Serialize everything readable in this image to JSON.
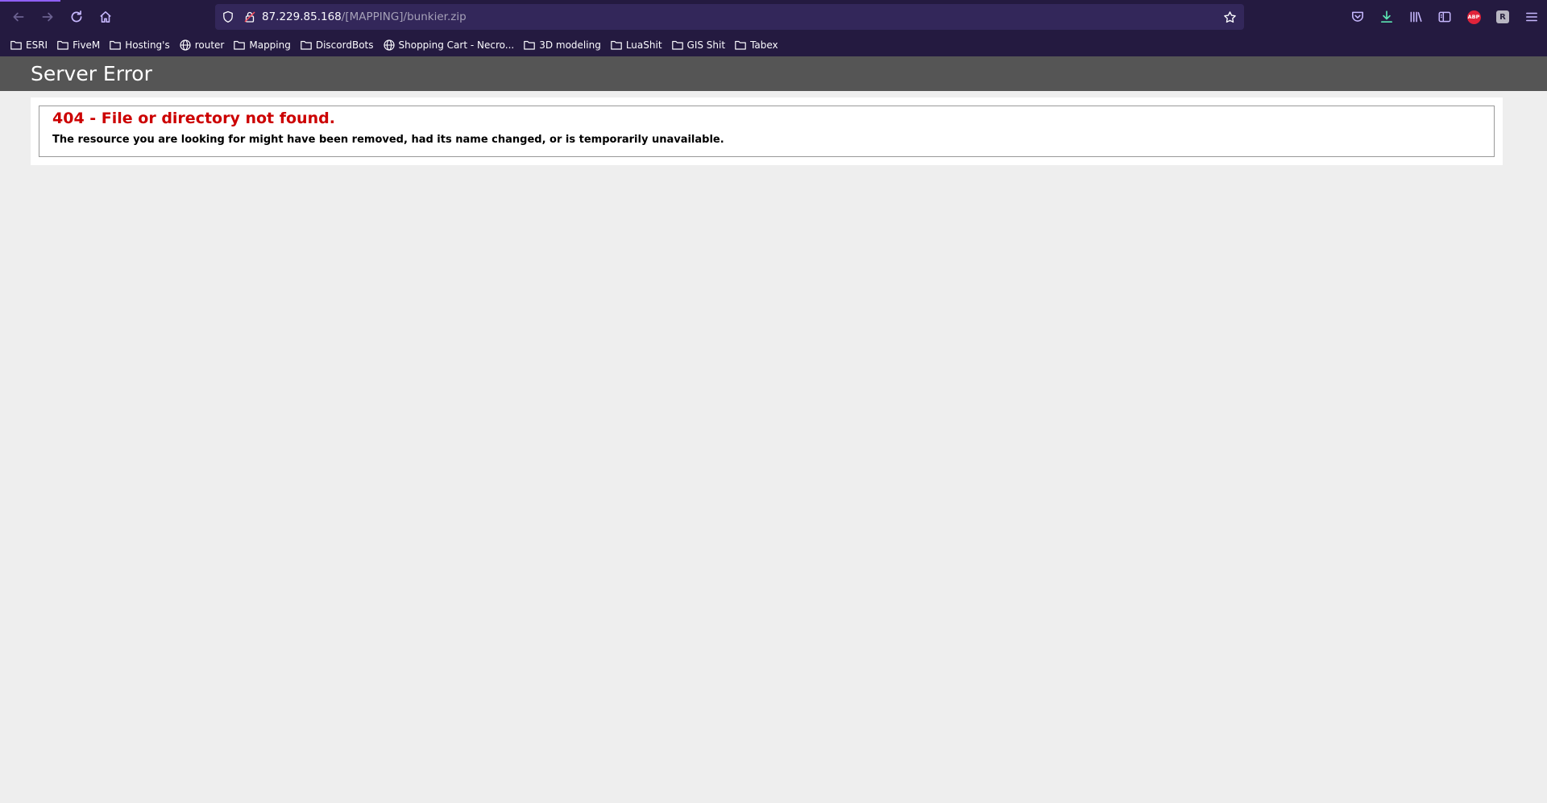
{
  "browser": {
    "url_host": "87.229.85.168",
    "url_path": "/[MAPPING]/bunkier.zip",
    "abp_label": "ABP",
    "ext_label": "R",
    "bookmarks": [
      {
        "label": "ESRI",
        "icon": "folder-icon"
      },
      {
        "label": "FiveM",
        "icon": "folder-icon"
      },
      {
        "label": "Hosting's",
        "icon": "folder-icon"
      },
      {
        "label": "router",
        "icon": "globe-icon"
      },
      {
        "label": "Mapping",
        "icon": "folder-icon"
      },
      {
        "label": "DiscordBots",
        "icon": "folder-icon"
      },
      {
        "label": "Shopping Cart - Necro...",
        "icon": "globe-icon"
      },
      {
        "label": "3D modeling",
        "icon": "folder-icon"
      },
      {
        "label": "LuaShit",
        "icon": "folder-icon"
      },
      {
        "label": "GIS Shit",
        "icon": "folder-icon"
      },
      {
        "label": "Tabex",
        "icon": "folder-icon"
      }
    ],
    "colors": {
      "chrome_bg": "#241a40",
      "urlbar_bg": "#33275a",
      "icon": "#c7b8ff"
    }
  },
  "page": {
    "header_title": "Server Error",
    "error_heading": "404 - File or directory not found.",
    "error_message": "The resource you are looking for might have been removed, had its name changed, or is temporarily unavailable.",
    "colors": {
      "header_bg": "#555555",
      "error_red": "#cc0000",
      "page_bg": "#eeeeee"
    }
  }
}
